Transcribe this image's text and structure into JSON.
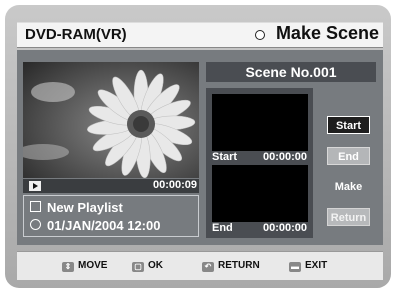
{
  "header": {
    "app_title": "DVD-RAM(VR)",
    "screen_title": "Make Scene"
  },
  "preview": {
    "timecode": "00:00:09"
  },
  "playlist": {
    "name": "New Playlist",
    "datetime": "01/JAN/2004 12:00"
  },
  "scene": {
    "number_label": "Scene No.001"
  },
  "start_thumb": {
    "label": "Start",
    "time": "00:00:00"
  },
  "end_thumb": {
    "label": "End",
    "time": "00:00:00"
  },
  "buttons": {
    "start": "Start",
    "end": "End",
    "make": "Make",
    "return": "Return"
  },
  "footer": {
    "move": "MOVE",
    "ok": "OK",
    "return": "RETURN",
    "exit": "EXIT"
  },
  "icons": {
    "move": "updown-icon",
    "ok": "ok-key-icon",
    "return": "return-icon",
    "exit": "exit-key-icon"
  }
}
